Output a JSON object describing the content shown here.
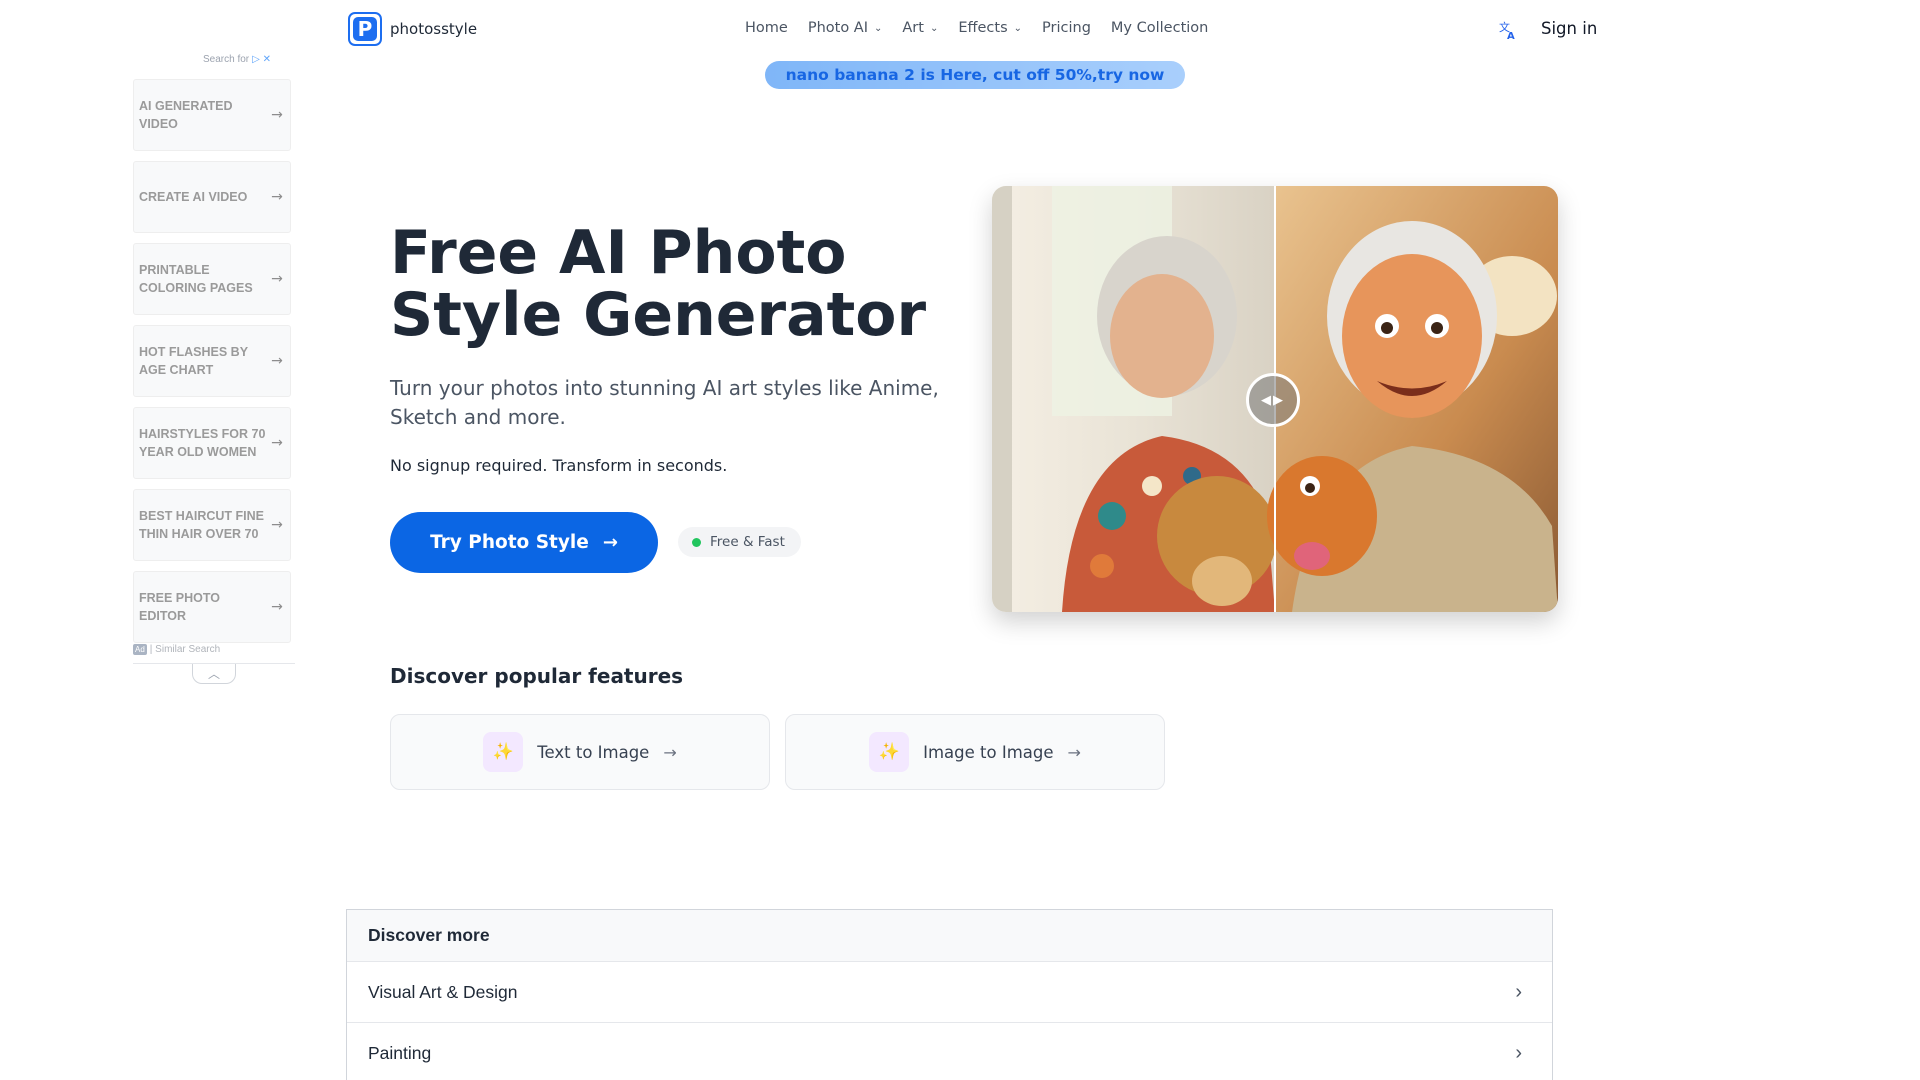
{
  "ads": {
    "search_for": "Search for",
    "items": [
      {
        "label": "AI GENERATED VIDEO"
      },
      {
        "label": "CREATE AI VIDEO"
      },
      {
        "label": "PRINTABLE COLORING PAGES"
      },
      {
        "label": "HOT FLASHES BY AGE CHART"
      },
      {
        "label": "HAIRSTYLES FOR 70 YEAR OLD WOMEN"
      },
      {
        "label": "BEST HAIRCUT FINE THIN HAIR OVER 70"
      },
      {
        "label": "FREE PHOTO EDITOR"
      }
    ],
    "badge": "Ad",
    "footer": "| Similar Search"
  },
  "header": {
    "logo_letter": "P",
    "brand": "photosstyle",
    "nav": [
      {
        "label": "Home",
        "dropdown": false
      },
      {
        "label": "Photo AI",
        "dropdown": true
      },
      {
        "label": "Art",
        "dropdown": true
      },
      {
        "label": "Effects",
        "dropdown": true
      },
      {
        "label": "Pricing",
        "dropdown": false
      },
      {
        "label": "My Collection",
        "dropdown": false
      }
    ],
    "signin": "Sign in"
  },
  "promo": "nano banana 2 is Here, cut off 50%,try now",
  "hero": {
    "title": "Free AI Photo Style Generator",
    "subtitle": "Turn your photos into stunning AI art styles like Anime, Sketch and more.",
    "note": "No signup required. Transform in seconds.",
    "cta": "Try Photo Style",
    "pill": "Free & Fast"
  },
  "features": {
    "title": "Discover popular features",
    "cards": [
      {
        "label": "Text to Image"
      },
      {
        "label": "Image to Image"
      }
    ]
  },
  "discover_more": {
    "title": "Discover more",
    "rows": [
      {
        "label": "Visual Art & Design"
      },
      {
        "label": "Painting"
      }
    ]
  },
  "colors": {
    "brand": "#0b66e4",
    "promo_text": "#1766e3",
    "feature_icon": "#9333ea",
    "status_dot": "#22c55e"
  }
}
